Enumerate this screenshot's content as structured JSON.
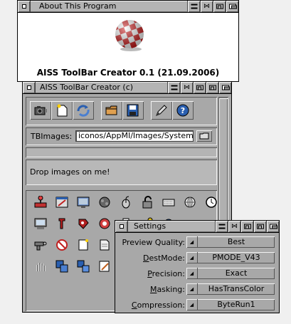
{
  "about": {
    "title": "About This Program",
    "caption": "AISS ToolBar Creator 0.1 (21.09.2006)"
  },
  "main": {
    "title": "AISS ToolBar Creator (c)",
    "tbimages_label": "TBImages:",
    "tbimages_value": "iconos/AppMI/Images/System/",
    "drop_text": "Drop images on me!",
    "toolbar_buttons": [
      "camera-icon",
      "new-icon",
      "refresh-icon",
      "drawer-icon",
      "save-icon",
      "edit-icon",
      "help-icon"
    ]
  },
  "settings": {
    "title": "Settings",
    "rows": [
      {
        "label_pre": "Preview Quality:",
        "label_u": "",
        "label_post": "",
        "value": "Best"
      },
      {
        "label_pre": "",
        "label_u": "D",
        "label_post": "estMode:",
        "value": "PMODE_V43"
      },
      {
        "label_pre": "",
        "label_u": "P",
        "label_post": "recision:",
        "value": "Exact"
      },
      {
        "label_pre": "",
        "label_u": "M",
        "label_post": "asking:",
        "value": "HasTransColor"
      },
      {
        "label_pre": "",
        "label_u": "C",
        "label_post": "ompression:",
        "value": "ByteRun1"
      }
    ]
  },
  "colors": {
    "window_bg": "#a8a8a8",
    "about_bg": "#ffffff",
    "accent_blue": "#2a5fb0",
    "accent_red": "#cc2020"
  }
}
